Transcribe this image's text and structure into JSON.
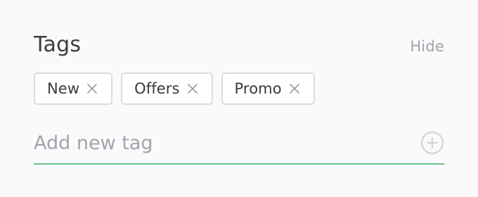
{
  "tags_panel": {
    "title": "Tags",
    "hide_label": "Hide",
    "tags": [
      {
        "label": "New",
        "remove_icon": "close-icon"
      },
      {
        "label": "Offers",
        "remove_icon": "close-icon"
      },
      {
        "label": "Promo",
        "remove_icon": "close-icon"
      }
    ],
    "add_input": {
      "value": "",
      "placeholder": "Add new tag"
    },
    "add_icon": "plus-circle-icon"
  },
  "colors": {
    "background": "#faf9fb",
    "accent_underline": "#66bf8e",
    "chip_border": "#dcdce0",
    "muted_text": "#a3a3a8",
    "primary_text": "#3d3d3f"
  }
}
